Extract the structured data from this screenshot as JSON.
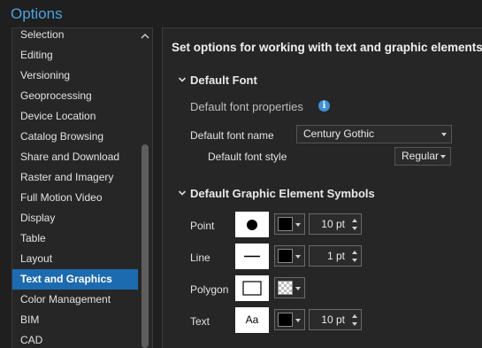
{
  "window": {
    "title": "Options"
  },
  "nav": {
    "items": [
      {
        "label": "Selection"
      },
      {
        "label": "Editing"
      },
      {
        "label": "Versioning"
      },
      {
        "label": "Geoprocessing"
      },
      {
        "label": "Device Location"
      },
      {
        "label": "Catalog Browsing"
      },
      {
        "label": "Share and Download"
      },
      {
        "label": "Raster and Imagery"
      },
      {
        "label": "Full Motion Video"
      },
      {
        "label": "Display"
      },
      {
        "label": "Table"
      },
      {
        "label": "Layout"
      },
      {
        "label": "Text and Graphics",
        "selected": true
      },
      {
        "label": "Color Management"
      },
      {
        "label": "BIM"
      },
      {
        "label": "CAD"
      }
    ]
  },
  "panel": {
    "heading": "Set options for working with text and graphic elements",
    "default_font": {
      "section_title": "Default Font",
      "subheading": "Default font properties",
      "info_icon": "i",
      "font_name_label": "Default font name",
      "font_name_value": "Century Gothic",
      "font_style_label": "Default font style",
      "font_style_value": "Regular"
    },
    "symbols": {
      "section_title": "Default Graphic Element Symbols",
      "rows": [
        {
          "label": "Point",
          "color": "#000000",
          "size": "10 pt"
        },
        {
          "label": "Line",
          "color": "#000000",
          "size": "1 pt"
        },
        {
          "label": "Polygon",
          "color": "transparent"
        },
        {
          "label": "Text",
          "preview_text": "Aa",
          "color": "#000000",
          "size": "10 pt"
        }
      ]
    }
  },
  "colors": {
    "accent": "#1c6bb0",
    "title": "#4aa3df",
    "info": "#3d8fd6"
  }
}
